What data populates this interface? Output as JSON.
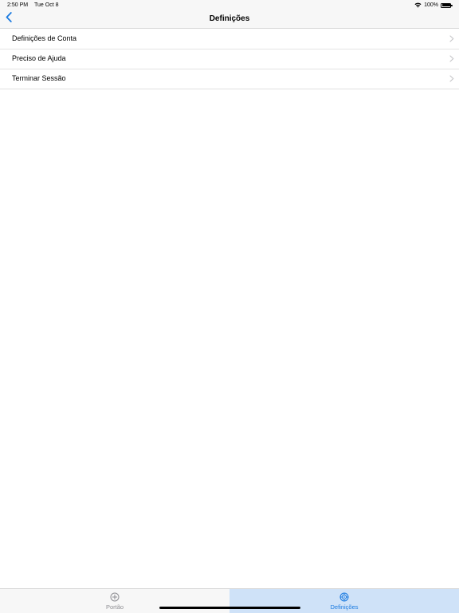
{
  "status_bar": {
    "time": "2:50 PM",
    "date": "Tue Oct 8",
    "battery": "100%",
    "icons": [
      "wifi-icon",
      "battery-icon"
    ]
  },
  "nav": {
    "title": "Definições",
    "back_icon": "chevron-left-icon"
  },
  "settings": {
    "items": [
      {
        "label": "Definições de Conta"
      },
      {
        "label": "Preciso de Ajuda"
      },
      {
        "label": "Terminar Sessão"
      }
    ]
  },
  "tab_bar": {
    "tabs": [
      {
        "label": "Portão",
        "icon": "add-circle-icon",
        "selected": false
      },
      {
        "label": "Definições",
        "icon": "gear-icon",
        "selected": true
      }
    ]
  },
  "colors": {
    "accent": "#1a7ae0",
    "selected_tab_bg": "#cfe2f8",
    "inactive_tab": "#8e8e93",
    "bar_bg": "#f7f7f7"
  }
}
